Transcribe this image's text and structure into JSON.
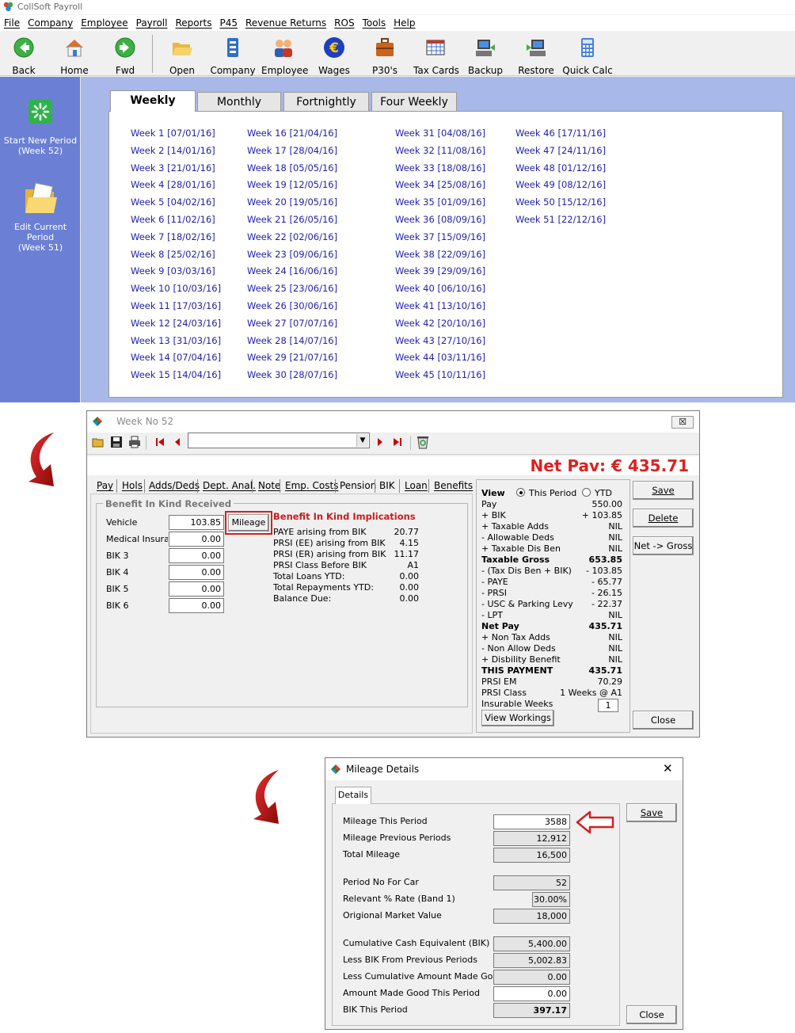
{
  "app": {
    "title": "CollSoft Payroll",
    "menu": [
      "File",
      "Company",
      "Employee",
      "Payroll",
      "Reports",
      "P45",
      "Revenue Returns",
      "ROS",
      "Tools",
      "Help"
    ],
    "toolbar": [
      {
        "label": "Back",
        "icon": "back-arrow-icon"
      },
      {
        "label": "Home",
        "icon": "home-icon"
      },
      {
        "label": "Fwd",
        "icon": "forward-arrow-icon"
      },
      {
        "label": "Open",
        "icon": "folder-open-icon"
      },
      {
        "label": "Company",
        "icon": "company-building-icon"
      },
      {
        "label": "Employee",
        "icon": "employee-people-icon"
      },
      {
        "label": "Wages",
        "icon": "euro-coin-icon"
      },
      {
        "label": "P30's",
        "icon": "briefcase-icon"
      },
      {
        "label": "Tax Cards",
        "icon": "tax-card-grid-icon"
      },
      {
        "label": "Backup",
        "icon": "backup-computer-icon"
      },
      {
        "label": "Restore",
        "icon": "restore-computer-icon"
      },
      {
        "label": "Quick Calc",
        "icon": "calculator-icon"
      }
    ],
    "sidebar": {
      "start_new_period": "Start New Period",
      "start_new_period_week": "(Week 52)",
      "edit_current_period": "Edit Current Period",
      "edit_current_period_week": "(Week 51)"
    },
    "period_tabs": [
      "Weekly",
      "Monthly",
      "Fortnightly",
      "Four Weekly"
    ],
    "weeks": {
      "col1": [
        "Week 1 [07/01/16]",
        "Week 2 [14/01/16]",
        "Week 3 [21/01/16]",
        "Week 4 [28/01/16]",
        "Week 5 [04/02/16]",
        "Week 6 [11/02/16]",
        "Week 7 [18/02/16]",
        "Week 8 [25/02/16]",
        "Week 9 [03/03/16]",
        "Week 10 [10/03/16]",
        "Week 11 [17/03/16]",
        "Week 12 [24/03/16]",
        "Week 13 [31/03/16]",
        "Week 14 [07/04/16]",
        "Week 15 [14/04/16]"
      ],
      "col2": [
        "Week 16 [21/04/16]",
        "Week 17 [28/04/16]",
        "Week 18 [05/05/16]",
        "Week 19 [12/05/16]",
        "Week 20 [19/05/16]",
        "Week 21 [26/05/16]",
        "Week 22 [02/06/16]",
        "Week 23 [09/06/16]",
        "Week 24 [16/06/16]",
        "Week 25 [23/06/16]",
        "Week 26 [30/06/16]",
        "Week 27 [07/07/16]",
        "Week 28 [14/07/16]",
        "Week 29 [21/07/16]",
        "Week 30 [28/07/16]"
      ],
      "col3": [
        "Week 31 [04/08/16]",
        "Week 32 [11/08/16]",
        "Week 33 [18/08/16]",
        "Week 34 [25/08/16]",
        "Week 35 [01/09/16]",
        "Week 36 [08/09/16]",
        "Week 37 [15/09/16]",
        "Week 38 [22/09/16]",
        "Week 39 [29/09/16]",
        "Week 40 [06/10/16]",
        "Week 41 [13/10/16]",
        "Week 42 [20/10/16]",
        "Week 43 [27/10/16]",
        "Week 44 [03/11/16]",
        "Week 45 [10/11/16]"
      ],
      "col4": [
        "Week 46 [17/11/16]",
        "Week 47 [24/11/16]",
        "Week 48 [01/12/16]",
        "Week 49 [08/12/16]",
        "Week 50 [15/12/16]",
        "Week 51 [22/12/16]"
      ]
    }
  },
  "week_dialog": {
    "title": "Week No 52",
    "close": "☒",
    "net_pay": "Net Pav: € 435.71",
    "tabs": [
      "Pay",
      "Hols",
      "Adds/Deds",
      "Dept. Anal.",
      "Note",
      "Emp. Costs",
      "Pension",
      "BIK",
      "Loan",
      "Benefits"
    ],
    "bik_group": "Benefit In Kind Received",
    "bik_fields": [
      {
        "label": "Vehicle",
        "value": "103.85"
      },
      {
        "label": "Medical Insuranc",
        "value": "0.00"
      },
      {
        "label": "BIK 3",
        "value": "0.00"
      },
      {
        "label": "BIK 4",
        "value": "0.00"
      },
      {
        "label": "BIK 5",
        "value": "0.00"
      },
      {
        "label": "BIK 6",
        "value": "0.00"
      }
    ],
    "mileage_button": "Mileage",
    "implications_title": "Benefit In Kind Implications",
    "implications": [
      {
        "label": "PAYE arising from BIK",
        "value": "20.77"
      },
      {
        "label": "PRSI (EE)  arising from BIK",
        "value": "4.15"
      },
      {
        "label": "PRSI (ER) arising from BIK",
        "value": "11.17"
      },
      {
        "label": "PRSI Class Before BIK",
        "value": "A1"
      },
      {
        "label": "Total Loans YTD:",
        "value": "0.00"
      },
      {
        "label": "Total Repayments YTD:",
        "value": "0.00"
      },
      {
        "label": "Balance Due:",
        "value": "0.00"
      }
    ],
    "view_label": "View",
    "view_this_period": "This Period",
    "view_ytd": "YTD",
    "summary": [
      {
        "k": "Pay",
        "v": "550.00",
        "bold": false
      },
      {
        "k": "+ BIK",
        "v": "+ 103.85",
        "bold": false
      },
      {
        "k": "+ Taxable Adds",
        "v": "NIL",
        "bold": false
      },
      {
        "k": "- Allowable Deds",
        "v": "NIL",
        "bold": false
      },
      {
        "k": "+ Taxable Dis Ben",
        "v": "NIL",
        "bold": false
      },
      {
        "k": "Taxable Gross",
        "v": "653.85",
        "bold": true
      },
      {
        "k": "- (Tax Dis Ben + BIK)",
        "v": "- 103.85",
        "bold": false
      },
      {
        "k": "- PAYE",
        "v": "- 65.77",
        "bold": false
      },
      {
        "k": "- PRSI",
        "v": "- 26.15",
        "bold": false
      },
      {
        "k": "- USC & Parking Levy",
        "v": "- 22.37",
        "bold": false
      },
      {
        "k": "- LPT",
        "v": "NIL",
        "bold": false
      },
      {
        "k": "Net Pay",
        "v": "435.71",
        "bold": true
      },
      {
        "k": "+ Non Tax Adds",
        "v": "NIL",
        "bold": false
      },
      {
        "k": "- Non Allow Deds",
        "v": "NIL",
        "bold": false
      },
      {
        "k": "+ Disbility Benefit",
        "v": "NIL",
        "bold": false
      },
      {
        "k": "THIS PAYMENT",
        "v": "435.71",
        "bold": true
      },
      {
        "k": "PRSI EM",
        "v": "70.29",
        "bold": false
      },
      {
        "k": "PRSI Class",
        "v": "1 Weeks @ A1",
        "bold": false
      }
    ],
    "insurable_weeks_label": "Insurable Weeks",
    "insurable_weeks": "1",
    "view_workings": "View Workings",
    "buttons": {
      "save": "Save",
      "delete": "Delete",
      "net_gross": "Net -> Gross",
      "close": "Close"
    }
  },
  "mileage_dialog": {
    "title": "Mileage Details",
    "tab": "Details",
    "rows": [
      {
        "label": "Mileage This Period",
        "value": "3588"
      },
      {
        "label": "Mileage Previous Periods",
        "value": "12,912"
      },
      {
        "label": "Total Mileage",
        "value": "16,500"
      },
      {
        "label": "Period No For Car",
        "value": "52"
      },
      {
        "label": "Relevant % Rate (Band 1)",
        "value": "30.00%"
      },
      {
        "label": "Origional Market Value",
        "value": "18,000"
      },
      {
        "label": "Cumulative Cash Equivalent (BIK)",
        "value": "5,400.00"
      },
      {
        "label": "Less BIK From Previous Periods",
        "value": "5,002.83"
      },
      {
        "label": "Less Cumulative Amount Made Good",
        "value": "0.00"
      },
      {
        "label": "Amount Made Good This Period",
        "value": "0.00"
      },
      {
        "label": "BIK This Period",
        "value": "397.17"
      }
    ],
    "buttons": {
      "save": "Save",
      "close": "Close"
    },
    "close": "✕"
  },
  "colors": {
    "net_pay": "#e02020",
    "link": "#1f1fa8",
    "sidebar": "#6b80d4",
    "main_bg": "#a8b8e8",
    "highlight": "#d42020"
  }
}
